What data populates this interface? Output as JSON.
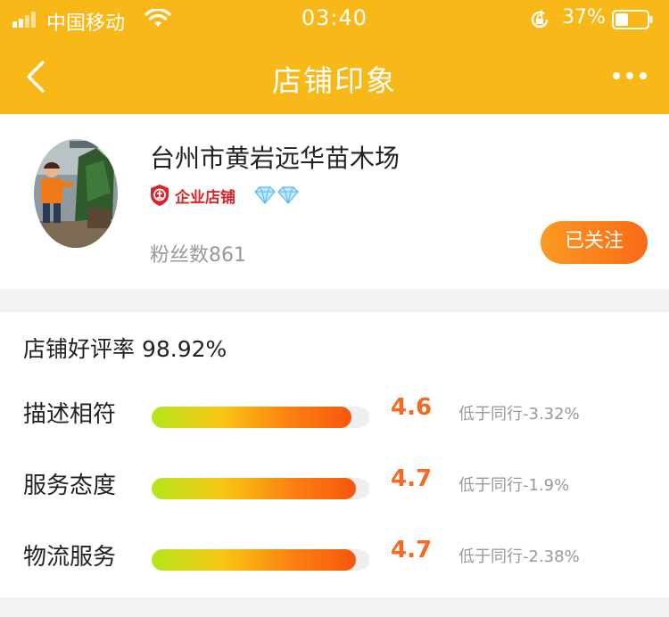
{
  "status_bar": {
    "carrier": "中国移动",
    "time": "03:40",
    "battery": "37%"
  },
  "nav": {
    "title": "店铺印象"
  },
  "shop": {
    "name": "台州市黄岩远华苗木场",
    "badge": "企业店铺",
    "diamond_count": 2,
    "fans": "粉丝数861",
    "follow_label": "已关注"
  },
  "ratings": {
    "good_rate": "店铺好评率 98.92%",
    "items": [
      {
        "label": "描述相符",
        "score": "4.6",
        "fill_percent": 92,
        "compare": "低于同行-3.32%"
      },
      {
        "label": "服务态度",
        "score": "4.7",
        "fill_percent": 94,
        "compare": "低于同行-1.9%"
      },
      {
        "label": "物流服务",
        "score": "4.7",
        "fill_percent": 94,
        "compare": "低于同行-2.38%"
      }
    ]
  },
  "colors": {
    "header_bg": "#f8b818",
    "accent_orange": "#f26a23",
    "badge_red": "#d9252b"
  }
}
